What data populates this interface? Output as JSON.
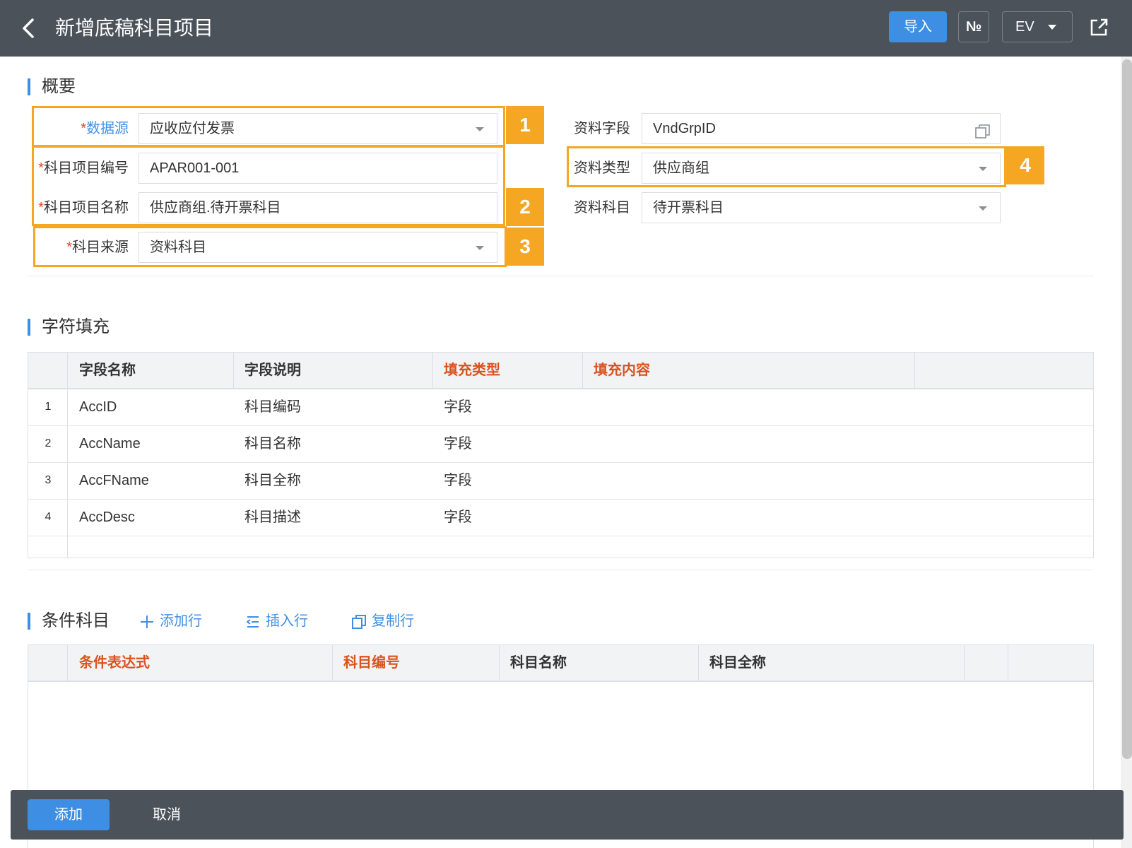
{
  "header": {
    "title": "新增底稿科目项目",
    "import_label": "导入",
    "no_label": "№",
    "ev_label": "EV"
  },
  "overview": {
    "section_title": "概要",
    "left_fields": [
      {
        "label": "数据源",
        "required_mark": "*",
        "value": "应收应付发票"
      },
      {
        "label": "科目项目编号",
        "required_mark": "*",
        "value": "APAR001-001"
      },
      {
        "label": "科目项目名称",
        "required_mark": "*",
        "value": "供应商组.待开票科目"
      },
      {
        "label": "科目来源",
        "required_mark": "*",
        "value": "资料科目"
      }
    ],
    "right_fields": [
      {
        "label": "资料字段",
        "value": "VndGrpID"
      },
      {
        "label": "资料类型",
        "value": "供应商组"
      },
      {
        "label": "资料科目",
        "value": "待开票科目"
      }
    ],
    "badges": [
      "1",
      "2",
      "3",
      "4"
    ]
  },
  "char_fill": {
    "section_title": "字符填充",
    "columns": [
      "字段名称",
      "字段说明",
      "填充类型",
      "填充内容"
    ],
    "rows": [
      {
        "n": "1",
        "name": "AccID",
        "desc": "科目编码",
        "type": "字段",
        "content": ""
      },
      {
        "n": "2",
        "name": "AccName",
        "desc": "科目名称",
        "type": "字段",
        "content": ""
      },
      {
        "n": "3",
        "name": "AccFName",
        "desc": "科目全称",
        "type": "字段",
        "content": ""
      },
      {
        "n": "4",
        "name": "AccDesc",
        "desc": "科目描述",
        "type": "字段",
        "content": ""
      }
    ]
  },
  "cond": {
    "section_title": "条件科目",
    "add_row": "添加行",
    "insert_row": "插入行",
    "copy_row": "复制行",
    "columns": [
      "条件表达式",
      "科目编号",
      "科目名称",
      "科目全称"
    ]
  },
  "footer": {
    "add_label": "添加",
    "cancel_label": "取消"
  },
  "colors": {
    "header_bg": "#4b525a",
    "accent": "#3e8fe3",
    "highlight": "#f5a623",
    "required": "#e0461e"
  }
}
